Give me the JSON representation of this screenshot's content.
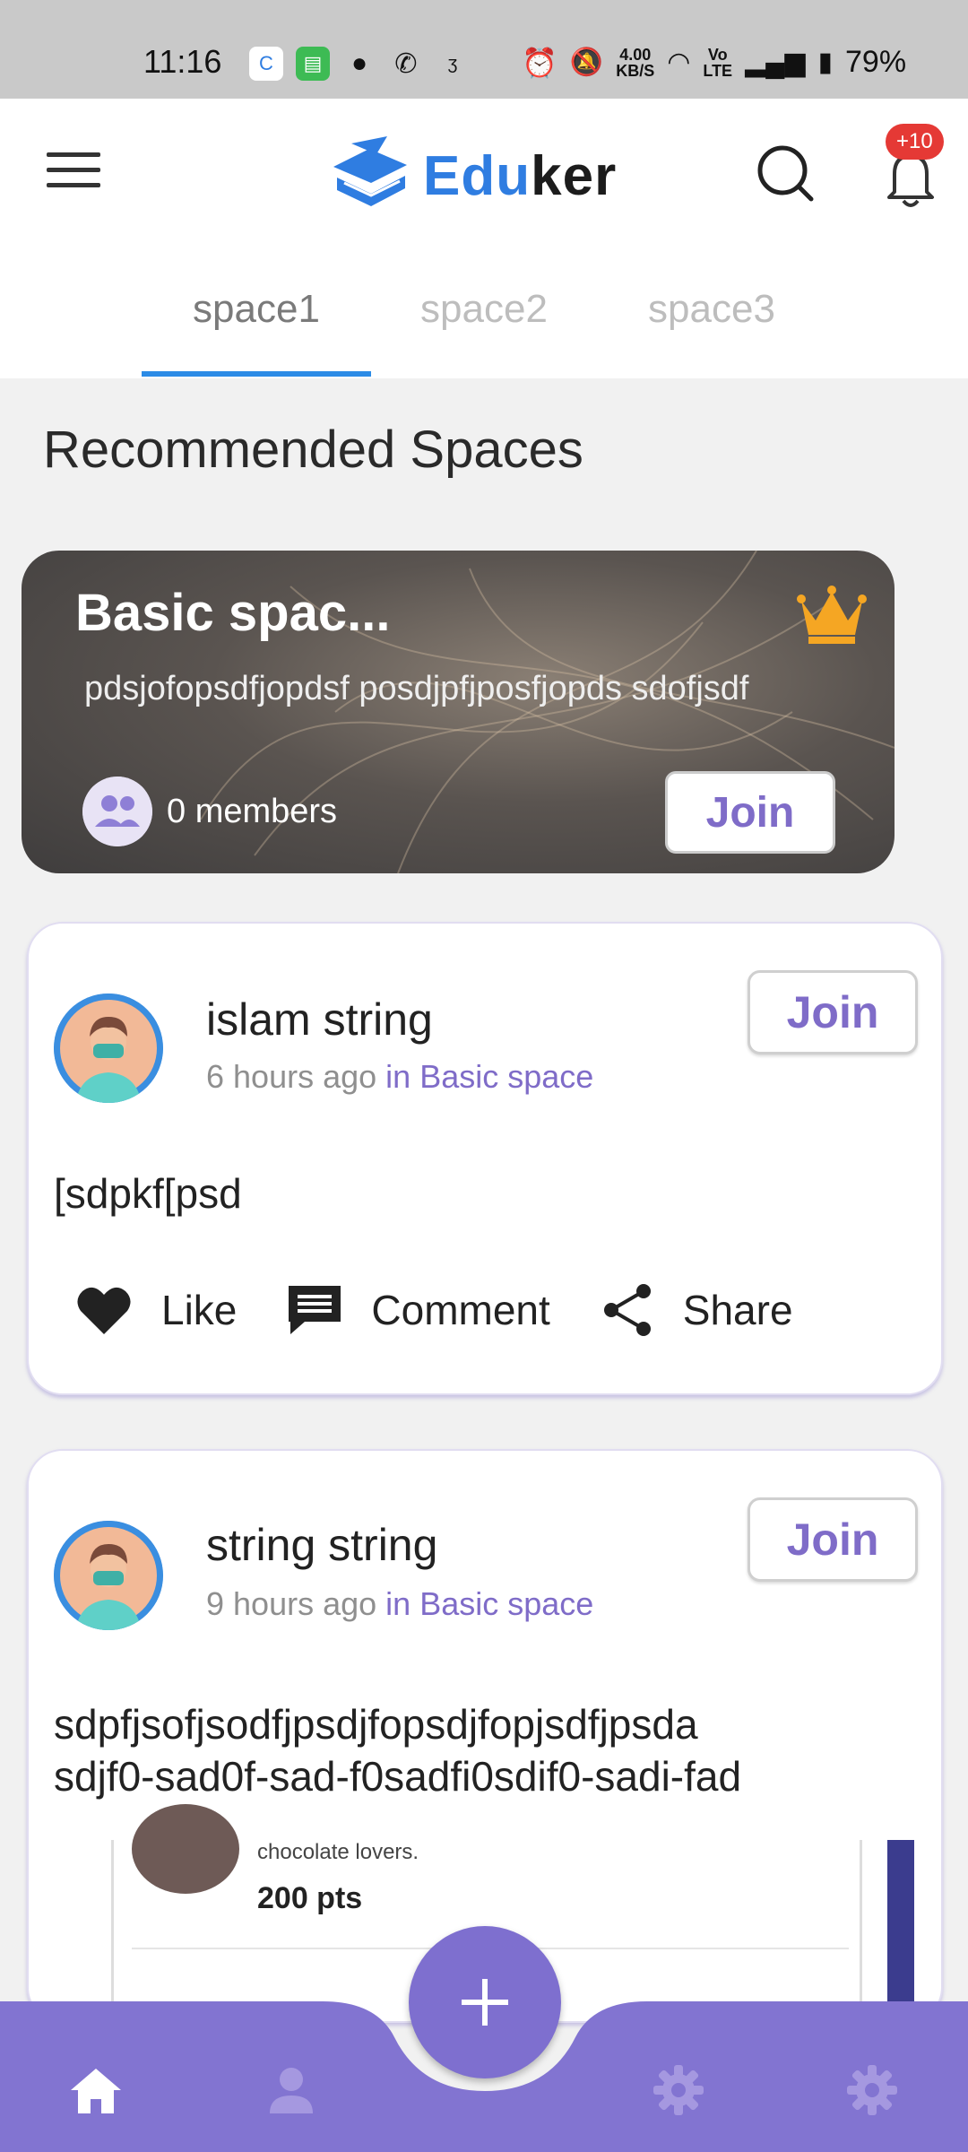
{
  "status_bar": {
    "time": "11:16",
    "net_speed": "4.00\nKB/S",
    "volte": "Vo\nLTE",
    "battery": "79%"
  },
  "header": {
    "logo_part1": "Edu",
    "logo_part2": "ker",
    "notification_badge": "+10"
  },
  "tabs": [
    {
      "label": "space1",
      "active": true
    },
    {
      "label": "space2",
      "active": false
    },
    {
      "label": "space3",
      "active": false
    }
  ],
  "section_title": "Recommended Spaces",
  "space_card": {
    "title": "Basic spac...",
    "description": "pdsjofopsdfjopdsf posdjpfjposfjopds sdofjsdf",
    "members": "0 members",
    "join_label": "Join"
  },
  "posts": [
    {
      "author": "islam string",
      "time": "6 hours ago",
      "in_text": "in Basic space",
      "join_label": "Join",
      "body": "[sdpkf[psd",
      "actions": {
        "like": "Like",
        "comment": "Comment",
        "share": "Share"
      }
    },
    {
      "author": "string string",
      "time": "9 hours ago",
      "in_text": "in Basic space",
      "join_label": "Join",
      "body": "sdpfjsofjsodfjpsdjfopsdjfopjsdfjpsda\nsdjf0-sad0f-sad-f0sadfi0sdif0-sadi-fad",
      "embed": {
        "snippet": "chocolate lovers.",
        "points": "200 pts"
      }
    }
  ],
  "colors": {
    "accent": "#7e6fcf",
    "logo_blue": "#2f7de1",
    "tab_indicator": "#2b8be6",
    "badge": "#e53935"
  },
  "bottom_nav": {
    "icons": [
      "home-icon",
      "person-icon",
      "add-icon",
      "settings-icon",
      "settings-icon"
    ]
  }
}
